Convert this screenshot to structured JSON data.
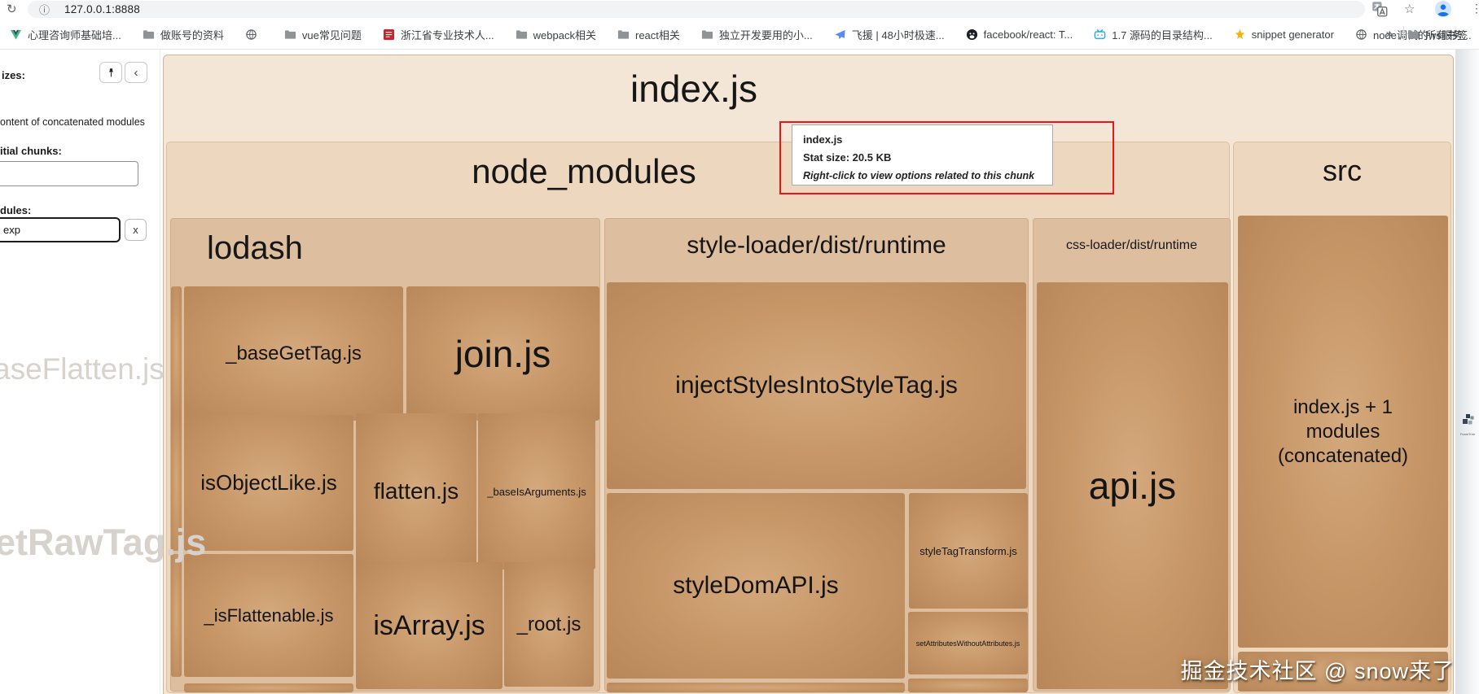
{
  "browser": {
    "url": "127.0.0.1:8888",
    "icons": {
      "reload": "↻",
      "info": "ⓘ",
      "star": "☆",
      "menu": "⋮",
      "overflow": "»"
    },
    "bookmarks": [
      {
        "icon": "vue-icon",
        "label": "心理咨询师基础培..."
      },
      {
        "icon": "folder-icon",
        "label": "做账号的资料"
      },
      {
        "icon": "globe-icon",
        "label": ""
      },
      {
        "icon": "folder-icon",
        "label": "vue常见问题"
      },
      {
        "icon": "seal-icon",
        "label": "浙江省专业技术人..."
      },
      {
        "icon": "folder-icon",
        "label": "webpack相关"
      },
      {
        "icon": "folder-icon",
        "label": "react相关"
      },
      {
        "icon": "folder-icon",
        "label": "独立开发要用的小..."
      },
      {
        "icon": "plane-icon",
        "label": "飞援 | 48小时极速..."
      },
      {
        "icon": "github-icon",
        "label": "facebook/react: T..."
      },
      {
        "icon": "bilibili-icon",
        "label": "1.7 源码的目录结构..."
      },
      {
        "icon": "star-icon",
        "label": "snippet generator"
      },
      {
        "icon": "globe-icon",
        "label": "node调试的ws服务..."
      }
    ],
    "all_bookmarks_label": "所有书签"
  },
  "sidebar": {
    "collapse_button": "‹",
    "sizes_label": "izes:",
    "concat_modules_label": "ontent of concatenated modules",
    "initial_chunks_label": "itial chunks:",
    "chunks_input_value": "",
    "modules_label": "dules:",
    "search_input_value": "exp",
    "clear_button": "x",
    "ghost_texts": [
      "aseFlatten.js",
      "etRawTag.js"
    ]
  },
  "treemap": {
    "chunk_label": "index.js",
    "groups": {
      "node_modules": {
        "label": "node_modules",
        "lodash": {
          "label": "lodash",
          "cells": [
            "_baseGetTag.js",
            "join.js",
            "isObjectLike.js",
            "flatten.js",
            "_baseIsArguments.js",
            "_isFlattenable.js",
            "isArray.js",
            "_root.js"
          ]
        },
        "style_loader": {
          "label": "style-loader/dist/runtime",
          "cells": [
            "injectStylesIntoStyleTag.js",
            "styleDomAPI.js",
            "styleTagTransform.js",
            "setAttributesWithoutAttributes.js"
          ]
        },
        "css_loader": {
          "label": "css-loader/dist/runtime",
          "cells": [
            "api.js"
          ]
        }
      },
      "src": {
        "label": "src",
        "concat_lines": [
          "index.js + 1",
          "modules",
          "(concatenated)"
        ]
      }
    }
  },
  "tooltip": {
    "title": "index.js",
    "stat": "Stat size: 20.5 KB",
    "hint": "Right-click to view options related to this chunk"
  },
  "watermark": "掘金技术社区 @ snow来了",
  "attribution": "FoamTree",
  "colors": {
    "leaf": "#c79768",
    "group": "#ddbe9f",
    "chunk_bg": "#f4e6d7",
    "red_annotation": "#ee1414",
    "accent_blue": "#1a73e8"
  }
}
